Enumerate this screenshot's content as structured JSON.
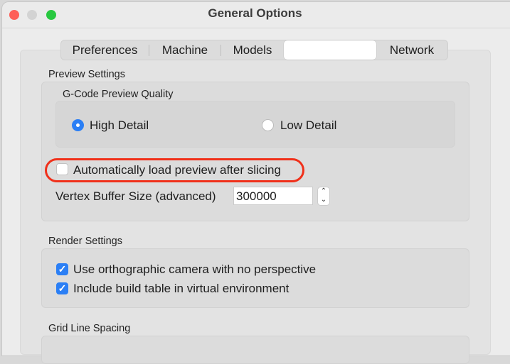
{
  "window": {
    "title": "General Options"
  },
  "tabs": [
    {
      "label": "Preferences"
    },
    {
      "label": "Machine"
    },
    {
      "label": "Models"
    },
    {
      "label": ""
    },
    {
      "label": "Network"
    }
  ],
  "preview": {
    "heading": "Preview Settings",
    "quality": {
      "heading": "G-Code Preview Quality",
      "options": [
        {
          "label": "High Detail",
          "selected": true
        },
        {
          "label": "Low Detail",
          "selected": false
        }
      ]
    },
    "auto_load": {
      "label": "Automatically load preview after slicing",
      "checked": false
    },
    "vertex_buffer": {
      "label": "Vertex Buffer Size (advanced)",
      "value": "300000"
    }
  },
  "render": {
    "heading": "Render Settings",
    "options": [
      {
        "label": "Use orthographic camera with no perspective",
        "checked": true
      },
      {
        "label": "Include build table in virtual environment",
        "checked": true
      }
    ]
  },
  "grid": {
    "heading": "Grid Line Spacing"
  },
  "colors": {
    "highlight": "#f0301a",
    "accent": "#2b7ff5"
  }
}
